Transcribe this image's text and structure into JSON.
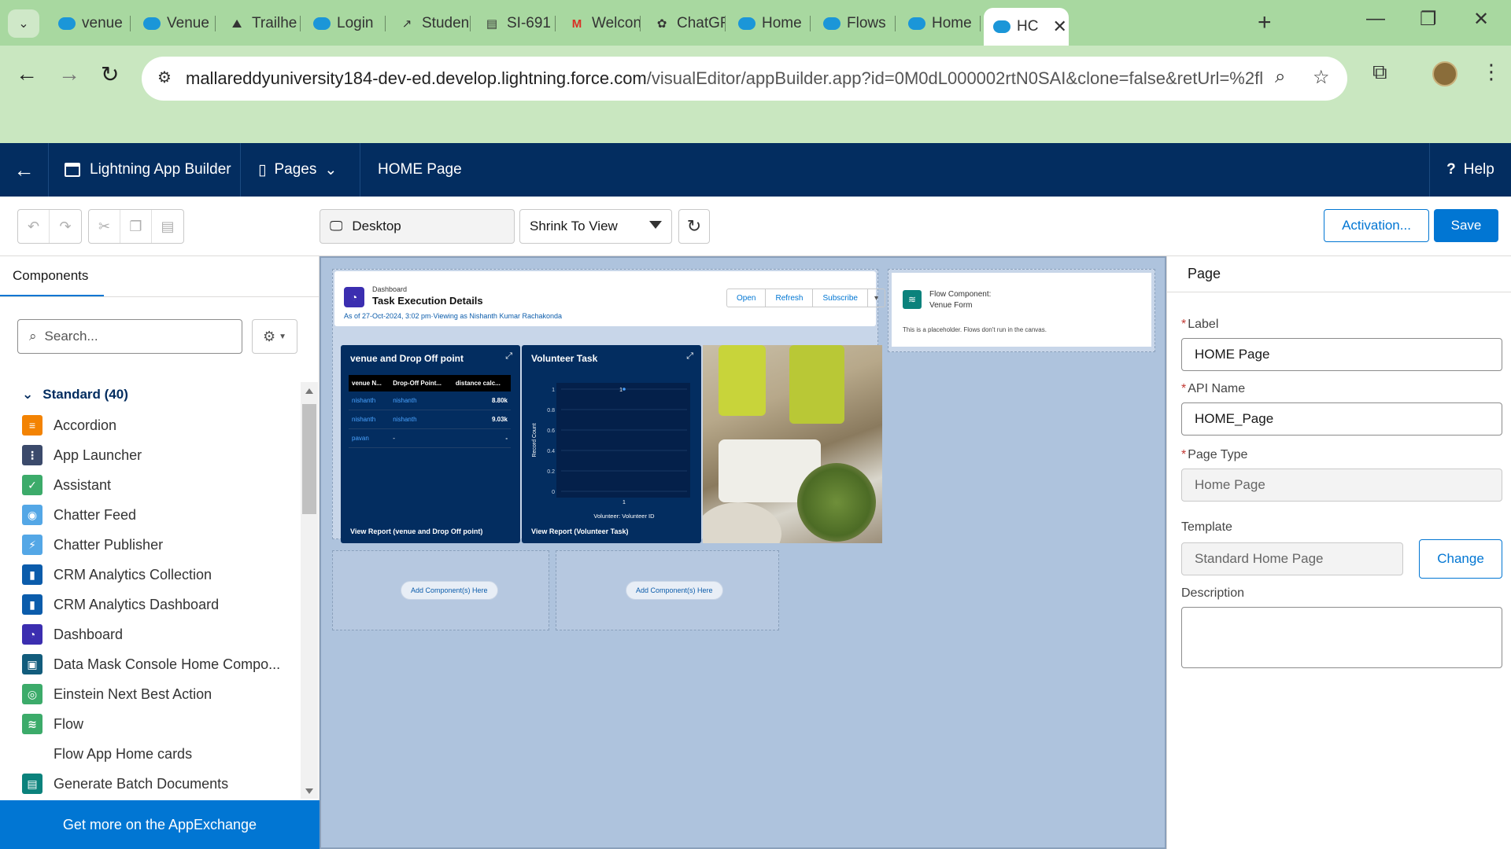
{
  "browser": {
    "tabs": [
      {
        "label": "venue",
        "icon": "salesforce-cloud-icon"
      },
      {
        "label": "Venue",
        "icon": "salesforce-cloud-icon"
      },
      {
        "label": "Trailhe",
        "icon": "trailhead-icon"
      },
      {
        "label": "Login",
        "icon": "salesforce-cloud-icon"
      },
      {
        "label": "Studen",
        "icon": "chart-icon"
      },
      {
        "label": "SI-691",
        "icon": "document-icon"
      },
      {
        "label": "Welcon",
        "icon": "gmail-icon"
      },
      {
        "label": "ChatGF",
        "icon": "chatgpt-icon"
      },
      {
        "label": "Home",
        "icon": "salesforce-cloud-icon"
      },
      {
        "label": "Flows",
        "icon": "salesforce-cloud-icon"
      },
      {
        "label": "Home",
        "icon": "salesforce-cloud-icon"
      },
      {
        "label": "HC",
        "icon": "salesforce-cloud-icon",
        "active": true
      }
    ],
    "url_host": "mallareddyuniversity184-dev-ed.develop.lightning.force.com",
    "url_path": "/visualEditor/appBuilder.app?id=0M0dL000002rtN0SAI&clone=false&retUrl=%2fligh..."
  },
  "sf_header": {
    "app_name": "Lightning App Builder",
    "pages_label": "Pages",
    "page_name": "HOME Page",
    "help_label": "Help"
  },
  "builder_toolbar": {
    "device": "Desktop",
    "zoom": "Shrink To View",
    "activation_label": "Activation...",
    "save_label": "Save"
  },
  "components_panel": {
    "tab_label": "Components",
    "search_placeholder": "Search...",
    "section_label": "Standard (40)",
    "items": [
      {
        "label": "Accordion",
        "color": "#f38303",
        "glyph": "≡"
      },
      {
        "label": "App Launcher",
        "color": "#3b4a6b",
        "glyph": "⋮"
      },
      {
        "label": "Assistant",
        "color": "#3cab6a",
        "glyph": "✓"
      },
      {
        "label": "Chatter Feed",
        "color": "#54a7e6",
        "glyph": "◉"
      },
      {
        "label": "Chatter Publisher",
        "color": "#54a7e6",
        "glyph": "⚡"
      },
      {
        "label": "CRM Analytics Collection",
        "color": "#0b5cab",
        "glyph": "▮"
      },
      {
        "label": "CRM Analytics Dashboard",
        "color": "#0b5cab",
        "glyph": "▮"
      },
      {
        "label": "Dashboard",
        "color": "#3b2eb0",
        "glyph": "◔"
      },
      {
        "label": "Data Mask Console Home Compo...",
        "color": "#125c7c",
        "glyph": "▣"
      },
      {
        "label": "Einstein Next Best Action",
        "color": "#3cab6a",
        "glyph": "◎"
      },
      {
        "label": "Flow",
        "color": "#3cab6a",
        "glyph": "≋"
      },
      {
        "label": "Flow App Home cards",
        "color": "#ffffff",
        "glyph": ""
      },
      {
        "label": "Generate Batch Documents",
        "color": "#0b827c",
        "glyph": "▤"
      }
    ],
    "appexchange_label": "Get more on the AppExchange"
  },
  "canvas": {
    "dashboard": {
      "kind_label": "Dashboard",
      "title": "Task Execution Details",
      "as_of": "As of 27-Oct-2024, 3:02 pm·Viewing as Nishanth Kumar Rachakonda",
      "buttons": [
        "Open",
        "Refresh",
        "Subscribe"
      ],
      "widget1": {
        "title": "venue and Drop Off point",
        "columns": [
          "venue N...",
          "Drop-Off Point...",
          "distance calc..."
        ],
        "rows": [
          [
            "nishanth",
            "nishanth",
            "8.80k"
          ],
          [
            "nishanth",
            "nishanth",
            "9.03k"
          ],
          [
            "pavan",
            "-",
            "-"
          ]
        ],
        "footer": "View Report (venue and Drop Off point)"
      },
      "widget2": {
        "title": "Volunteer Task",
        "footer": "View Report (Volunteer Task)"
      }
    },
    "chart_data": {
      "type": "scatter",
      "title": "Volunteer Task",
      "xlabel": "Volunteer: Volunteer ID",
      "ylabel": "Record Count",
      "categories": [
        "1"
      ],
      "values": [
        1
      ],
      "point_labels": [
        "1"
      ],
      "y_ticks": [
        "1",
        "0.8",
        "0.6",
        "0.4",
        "0.2",
        "0"
      ],
      "ylim": [
        0,
        1
      ],
      "grid": true
    },
    "dropzone_label": "Add Component(s) Here",
    "flow": {
      "title": "Flow Component:",
      "name": "Venue Form",
      "note": "This is a placeholder. Flows don't run in the canvas."
    }
  },
  "properties_panel": {
    "header": "Page",
    "label_label": "Label",
    "label_value": "HOME Page",
    "api_label": "API Name",
    "api_value": "HOME_Page",
    "type_label": "Page Type",
    "type_value": "Home Page",
    "template_label": "Template",
    "template_value": "Standard Home Page",
    "change_label": "Change",
    "description_label": "Description"
  }
}
